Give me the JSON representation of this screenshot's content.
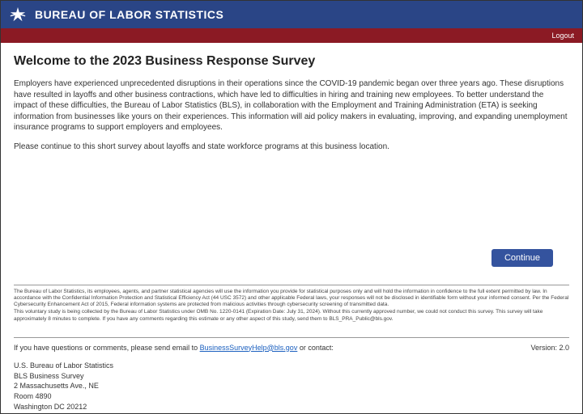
{
  "header": {
    "site_title": "BUREAU OF LABOR STATISTICS",
    "logout": "Logout"
  },
  "main": {
    "welcome": "Welcome to the 2023 Business Response Survey",
    "intro_p1": "Employers have experienced unprecedented disruptions in their operations since the COVID-19 pandemic began over three years ago. These disruptions have resulted in layoffs and other business contractions, which have led to difficulties in hiring and training new employees. To better understand the impact of these difficulties, the Bureau of Labor Statistics (BLS), in collaboration with the Employment and Training Administration (ETA) is seeking information from businesses like yours on their experiences. This information will aid policy makers in evaluating, improving, and expanding unemployment insurance programs to support employers and employees.",
    "intro_p2": "Please continue to this short survey about layoffs and state workforce programs at this business location.",
    "continue_label": "Continue"
  },
  "disclaimer": {
    "p1": "The Bureau of Labor Statistics, its employees, agents, and partner statistical agencies will use the information you provide for statistical purposes only and will hold the information in confidence to the full extent permitted by law. In accordance with the Confidential Information Protection and Statistical Efficiency Act (44 USC 3572) and other applicable Federal laws, your responses will not be disclosed in identifiable form without your informed consent. Per the Federal Cybersecurity Enhancement Act of 2015, Federal information systems are protected from malicious activities through cybersecurity screening of transmitted data.",
    "p2": "This voluntary study is being collected by the Bureau of Labor Statistics under OMB No. 1220-0141 (Expiration Date: July 31, 2024). Without this currently approved number, we could not conduct this survey. This survey will take approximately 8 minutes to complete. If you have any comments regarding this estimate or any other aspect of this study, send them to BLS_PRA_Public@bls.gov."
  },
  "footer": {
    "help_prefix": "If you have questions or comments, please send email to ",
    "help_email": "BusinessSurveyHelp@bls.gov",
    "help_suffix": " or contact:",
    "version_label": "Version: 2.0",
    "address": {
      "l1": "U.S. Bureau of Labor Statistics",
      "l2": "BLS Business Survey",
      "l3": "2 Massachusetts Ave., NE",
      "l4": "Room 4890",
      "l5": "Washington DC 20212"
    }
  }
}
